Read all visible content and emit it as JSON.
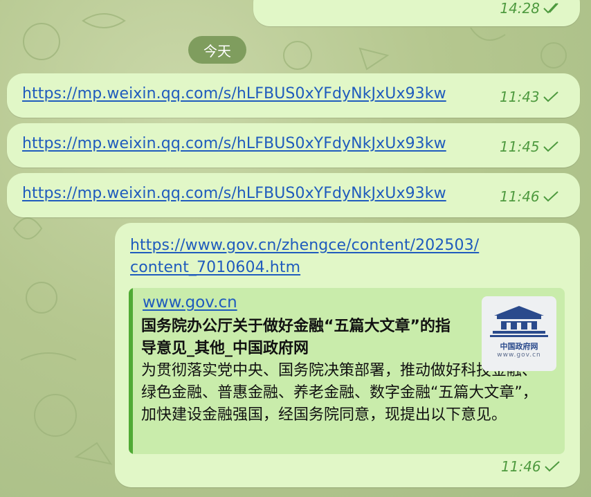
{
  "top_message": {
    "time": "14:28"
  },
  "date_separator": "今天",
  "messages": [
    {
      "url": "https://mp.weixin.qq.com/s/hLFBUS0xYFdyNkJxUx93kw",
      "time": "11:43"
    },
    {
      "url": "https://mp.weixin.qq.com/s/hLFBUS0xYFdyNkJxUx93kw",
      "time": "11:45"
    },
    {
      "url": "https://mp.weixin.qq.com/s/hLFBUS0xYFdyNkJxUx93kw",
      "time": "11:46"
    }
  ],
  "rich_message": {
    "url_line1": "https://www.gov.cn/zhengce/content/202503/",
    "url_line2": "content_7010604.htm",
    "time": "11:46",
    "preview": {
      "site": "www.gov.cn",
      "title": "国务院办公厅关于做好金融“五篇大文章”的指导意见_其他_中国政府网",
      "description": "为贯彻落实党中央、国务院决策部署，推动做好科技金融、绿色金融、普惠金融、养老金融、数字金融“五篇大文章”，加快建设金融强国，经国务院同意，现提出以下意见。",
      "thumbnail_title": "中国政府网",
      "thumbnail_url": "www.gov.cn"
    }
  },
  "colors": {
    "bubble": "#e1f7c7",
    "link": "#1f5bbd",
    "time": "#4e9a3f",
    "preview_bar": "#4faa34",
    "date_pill": "#7f9d5e"
  },
  "icons": {
    "read_receipt": "double-check-icon",
    "sent_receipt": "single-check-icon"
  }
}
